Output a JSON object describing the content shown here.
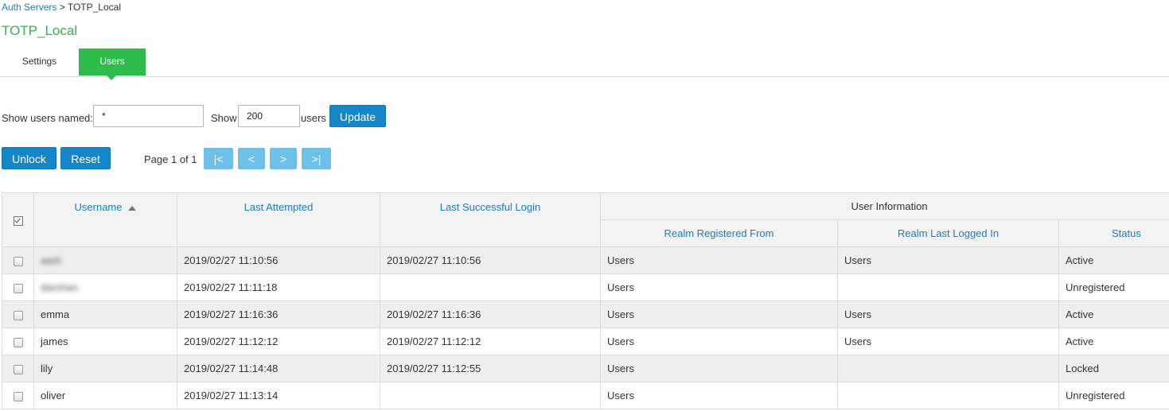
{
  "breadcrumb": {
    "parent": "Auth Servers",
    "separator": " > ",
    "current": "TOTP_Local"
  },
  "title": "TOTP_Local",
  "tabs": [
    {
      "label": "Settings",
      "active": false
    },
    {
      "label": "Users",
      "active": true
    }
  ],
  "filter": {
    "show_users_named_label": "Show users named:",
    "name_value": "*",
    "show_label": "Show",
    "count_value": "200",
    "users_label": "users",
    "update_label": "Update"
  },
  "actions": {
    "unlock_label": "Unlock",
    "reset_label": "Reset"
  },
  "pagination": {
    "info": "Page 1 of 1",
    "first": "|<",
    "prev": "<",
    "next": ">",
    "last": ">|"
  },
  "table": {
    "headers": {
      "username": "Username",
      "last_attempted": "Last Attempted",
      "last_successful_login": "Last Successful Login",
      "user_information": "User Information",
      "realm_registered_from": "Realm Registered From",
      "realm_last_logged_in": "Realm Last Logged In",
      "status": "Status"
    },
    "sort": {
      "column": "username",
      "direction": "ascending"
    },
    "rows": [
      {
        "username": "aarti",
        "last_attempted": "2019/02/27 11:10:56",
        "last_success": "2019/02/27 11:10:56",
        "realm_registered": "Users",
        "realm_last": "Users",
        "status": "Active"
      },
      {
        "username": "darshan",
        "last_attempted": "2019/02/27 11:11:18",
        "last_success": "",
        "realm_registered": "Users",
        "realm_last": "",
        "status": "Unregistered"
      },
      {
        "username": "emma",
        "last_attempted": "2019/02/27 11:16:36",
        "last_success": "2019/02/27 11:16:36",
        "realm_registered": "Users",
        "realm_last": "Users",
        "status": "Active"
      },
      {
        "username": "james",
        "last_attempted": "2019/02/27 11:12:12",
        "last_success": "2019/02/27 11:12:12",
        "realm_registered": "Users",
        "realm_last": "Users",
        "status": "Active"
      },
      {
        "username": "lily",
        "last_attempted": "2019/02/27 11:14:48",
        "last_success": "2019/02/27 11:12:55",
        "realm_registered": "Users",
        "realm_last": "",
        "status": "Locked"
      },
      {
        "username": "oliver",
        "last_attempted": "2019/02/27 11:13:14",
        "last_success": "",
        "realm_registered": "Users",
        "realm_last": "",
        "status": "Unregistered"
      }
    ]
  },
  "colors": {
    "accent_green": "#2ebd4b",
    "link_blue": "#1a7dc4",
    "button_blue": "#1587c8",
    "pager_blue": "#6fc0e8"
  },
  "icons": {
    "sort": "sort-ascending-icon",
    "select_all": "select-all-icon"
  }
}
